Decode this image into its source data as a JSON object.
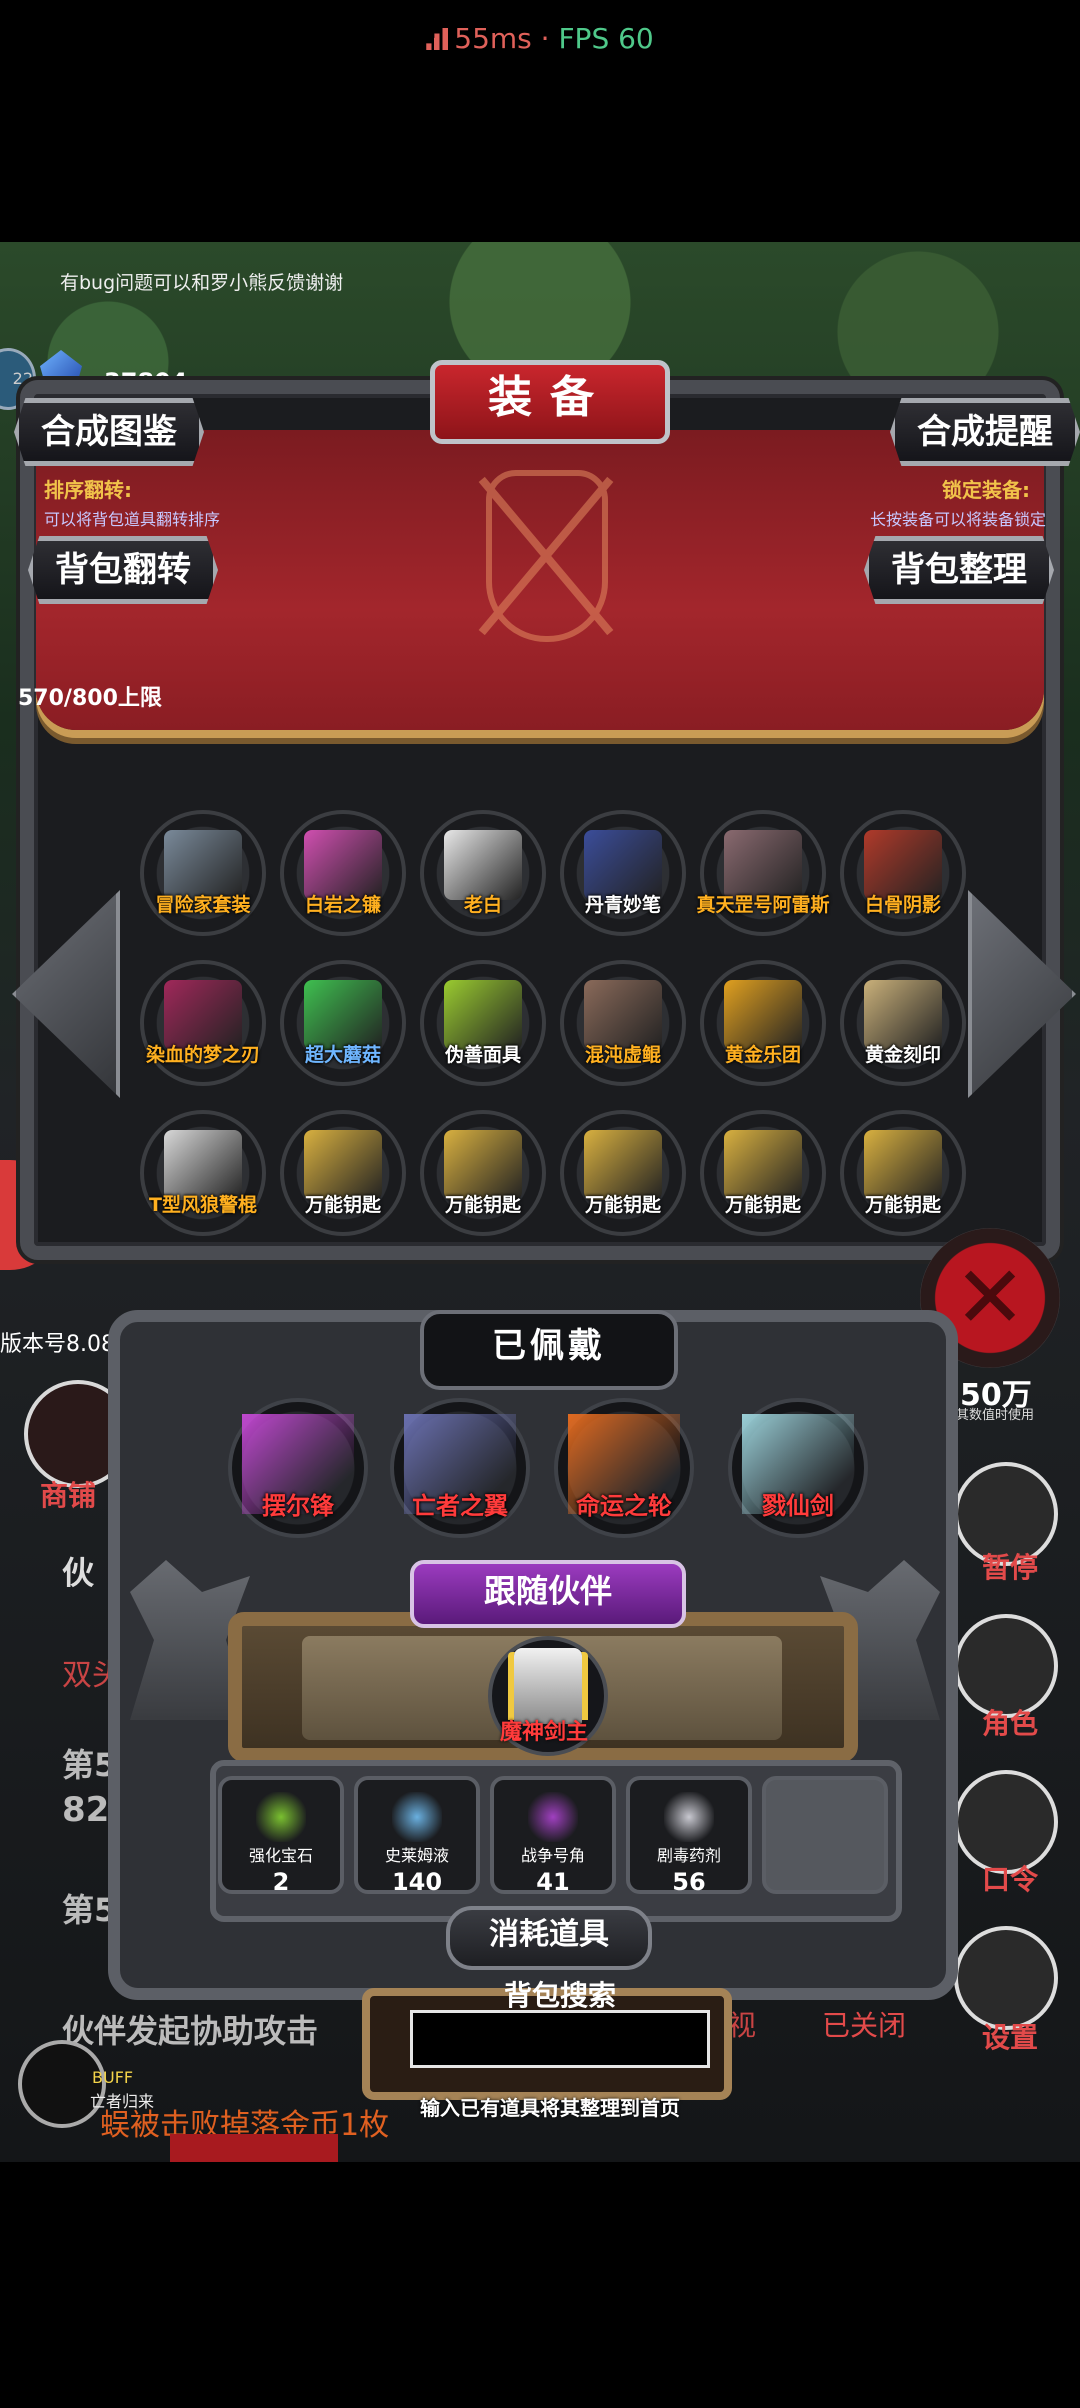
{
  "status": {
    "ping": "55ms",
    "sep": " · ",
    "fps": "FPS 60"
  },
  "notice": "有bug问题可以和罗小熊反馈谢谢",
  "currency": {
    "gems": "37804",
    "badge": "22"
  },
  "title": "装备",
  "buttons": {
    "synth_guide": "合成图鉴",
    "synth_remind": "合成提醒",
    "bag_flip": "背包翻转",
    "bag_sort": "背包整理"
  },
  "hints": {
    "sort_title": "排序翻转:",
    "sort_text": "可以将背包道具翻转排序",
    "lock_title": "锁定装备:",
    "lock_text": "长按装备可以将装备锁定"
  },
  "capacity": "570/800上限",
  "inventory": [
    {
      "name": "冒险家套装",
      "color": "gold",
      "art": "#7a8a9a"
    },
    {
      "name": "白岩之镰",
      "color": "gold",
      "art": "#d04fb0"
    },
    {
      "name": "老白",
      "color": "gold",
      "art": "#e8e8e8"
    },
    {
      "name": "丹青妙笔",
      "color": "white",
      "art": "#3b4d9a"
    },
    {
      "name": "真天罡号阿雷斯",
      "color": "gold",
      "art": "#8a6a70"
    },
    {
      "name": "白骨阴影",
      "color": "gold",
      "art": "#b03a2a"
    },
    {
      "name": "染血的梦之刃",
      "color": "gold",
      "art": "#a0285a"
    },
    {
      "name": "超大蘑菇",
      "color": "blue",
      "art": "#3fc050"
    },
    {
      "name": "伪善面具",
      "color": "white",
      "art": "#9acb30"
    },
    {
      "name": "混沌虚鲲",
      "color": "gold",
      "art": "#8a6a5a"
    },
    {
      "name": "黄金乐团",
      "color": "gold",
      "art": "#e0a020"
    },
    {
      "name": "黄金刻印",
      "color": "white",
      "art": "#c9b07a"
    },
    {
      "name": "T型风狼警棍",
      "color": "gold",
      "art": "#d8d8d8"
    },
    {
      "name": "万能钥匙",
      "color": "white",
      "art": "#d8b040"
    },
    {
      "name": "万能钥匙",
      "color": "white",
      "art": "#d8b040"
    },
    {
      "name": "万能钥匙",
      "color": "white",
      "art": "#d8b040"
    },
    {
      "name": "万能钥匙",
      "color": "white",
      "art": "#d8b040"
    },
    {
      "name": "万能钥匙",
      "color": "white",
      "art": "#d8b040"
    }
  ],
  "equipped": {
    "title": "已佩戴",
    "items": [
      {
        "name": "摆尔锋",
        "art": "#c048d0"
      },
      {
        "name": "亡者之翼",
        "art": "#6a70b0"
      },
      {
        "name": "命运之轮",
        "art": "#e06a20"
      },
      {
        "name": "戮仙剑",
        "art": "#9ad0d8"
      }
    ]
  },
  "companion": {
    "title": "跟随伙伴",
    "name": "魔神剑主"
  },
  "consumables": {
    "title": "消耗道具",
    "items": [
      {
        "name": "强化宝石",
        "count": "2",
        "art": "#7ac030"
      },
      {
        "name": "史莱姆液",
        "count": "140",
        "art": "#6ab0e0"
      },
      {
        "name": "战争号角",
        "count": "41",
        "art": "#a040c0"
      },
      {
        "name": "剧毒药剂",
        "count": "56",
        "art": "#c8c8d0"
      }
    ]
  },
  "search": {
    "label": "背包搜索",
    "placeholder": "",
    "hint": "输入已有道具将其整理到首页"
  },
  "background": {
    "version": "版本号8.08",
    "shop": "商铺",
    "line1": "伙",
    "line2": "双头食",
    "line3": "第5",
    "line4": "824",
    "line5": "第5",
    "line6": "伙伴发起协助攻击",
    "line7": "蜈被击败掉落金币1枚",
    "view": "无视",
    "closed": "已关闭",
    "counter": "50万",
    "counter_sub": "其数值时使用",
    "side_pause": "暂停",
    "side_role": "角色",
    "side_code": "口令",
    "side_settings": "设置",
    "buff": "BUFF",
    "buff_name": "亡者归来"
  }
}
